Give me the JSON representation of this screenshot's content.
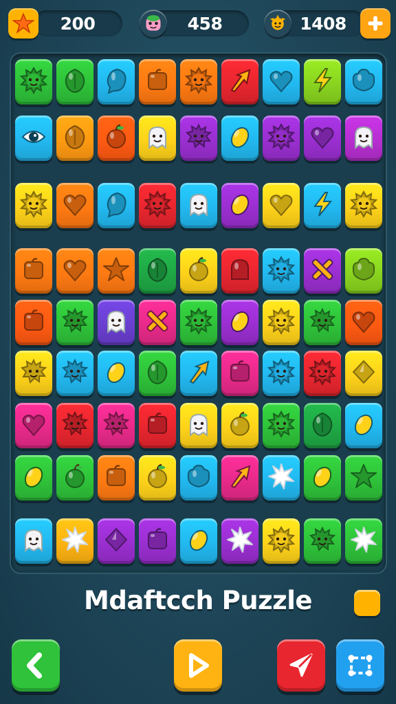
{
  "hud": {
    "coins": "200",
    "lives": "458",
    "score": "1408"
  },
  "board": {
    "rows": [
      [
        {
          "color": "#2fc23a",
          "icon": "sun-face"
        },
        {
          "color": "#2fc23a",
          "icon": "leaf"
        },
        {
          "color": "#22b8f0",
          "icon": "drop"
        },
        {
          "color": "#ff7a12",
          "icon": "block"
        },
        {
          "color": "#ff7a12",
          "icon": "sun-face"
        },
        {
          "color": "#e8262f",
          "icon": "arrow"
        },
        {
          "color": "#22b8f0",
          "icon": "heart"
        },
        {
          "color": "#8ad420",
          "icon": "bolt"
        },
        {
          "color": "#22b8f0",
          "icon": "blob"
        }
      ],
      [
        {
          "color": "#22b8f0",
          "icon": "eye"
        },
        {
          "color": "#ff9a12",
          "icon": "leaf"
        },
        {
          "color": "#ff5a12",
          "icon": "apple"
        },
        {
          "color": "#ffd21a",
          "icon": "ghost-face"
        },
        {
          "color": "#9a2fd0",
          "icon": "spiky"
        },
        {
          "color": "#22b8f0",
          "icon": "lemon"
        },
        {
          "color": "#9a2fd0",
          "icon": "sun-face"
        },
        {
          "color": "#9a2fd0",
          "icon": "heart"
        },
        {
          "color": "#b62fd0",
          "icon": "ghost-face"
        }
      ],
      [
        {
          "color": "#ffd21a",
          "icon": "sun-face"
        },
        {
          "color": "#ff7a12",
          "icon": "heart"
        },
        {
          "color": "#22b8f0",
          "icon": "drop"
        },
        {
          "color": "#e8262f",
          "icon": "sun-face"
        },
        {
          "color": "#22b8f0",
          "icon": "ghost-face"
        },
        {
          "color": "#9a2fd0",
          "icon": "lemon"
        },
        {
          "color": "#ffd21a",
          "icon": "heart"
        },
        {
          "color": "#22b8f0",
          "icon": "bolt"
        },
        {
          "color": "#ffd21a",
          "icon": "sun-face"
        }
      ],
      [
        {
          "color": "#ff7a12",
          "icon": "block"
        },
        {
          "color": "#ff7a12",
          "icon": "heart"
        },
        {
          "color": "#ff7a12",
          "icon": "star"
        },
        {
          "color": "#1fa845",
          "icon": "leaf"
        },
        {
          "color": "#ffd21a",
          "icon": "apple"
        },
        {
          "color": "#e8262f",
          "icon": "bell"
        },
        {
          "color": "#22b8f0",
          "icon": "sun-face"
        },
        {
          "color": "#9a2fd0",
          "icon": "cross"
        },
        {
          "color": "#8ad420",
          "icon": "blob"
        }
      ],
      [
        {
          "color": "#ff5a12",
          "icon": "block"
        },
        {
          "color": "#2fc23a",
          "icon": "spiky"
        },
        {
          "color": "#6a3fd0",
          "icon": "ghost-face"
        },
        {
          "color": "#e82a8a",
          "icon": "cross"
        },
        {
          "color": "#2fc23a",
          "icon": "sun-face"
        },
        {
          "color": "#9a2fd0",
          "icon": "lemon"
        },
        {
          "color": "#ffd21a",
          "icon": "sun-face"
        },
        {
          "color": "#2fc23a",
          "icon": "spiky"
        },
        {
          "color": "#ff5a12",
          "icon": "heart"
        }
      ],
      [
        {
          "color": "#ffd21a",
          "icon": "spiky"
        },
        {
          "color": "#22b8f0",
          "icon": "spiky"
        },
        {
          "color": "#22b8f0",
          "icon": "lemon"
        },
        {
          "color": "#2fc23a",
          "icon": "leaf"
        },
        {
          "color": "#22b8f0",
          "icon": "arrow"
        },
        {
          "color": "#e82a8a",
          "icon": "block"
        },
        {
          "color": "#22b8f0",
          "icon": "sun-face"
        },
        {
          "color": "#e8262f",
          "icon": "sun-face"
        },
        {
          "color": "#ffd21a",
          "icon": "diamond"
        }
      ],
      [
        {
          "color": "#e82a8a",
          "icon": "heart"
        },
        {
          "color": "#e8262f",
          "icon": "spiky"
        },
        {
          "color": "#e82a8a",
          "icon": "spiky"
        },
        {
          "color": "#e8262f",
          "icon": "block"
        },
        {
          "color": "#ffd21a",
          "icon": "ghost-face"
        },
        {
          "color": "#ffd21a",
          "icon": "apple"
        },
        {
          "color": "#2fc23a",
          "icon": "sun-face"
        },
        {
          "color": "#1fa845",
          "icon": "leaf"
        },
        {
          "color": "#22b8f0",
          "icon": "lemon"
        }
      ],
      [
        {
          "color": "#2fc23a",
          "icon": "lemon"
        },
        {
          "color": "#2fc23a",
          "icon": "apple"
        },
        {
          "color": "#ff7a12",
          "icon": "block"
        },
        {
          "color": "#ffd21a",
          "icon": "apple"
        },
        {
          "color": "#22b8f0",
          "icon": "blob"
        },
        {
          "color": "#e82a8a",
          "icon": "arrow"
        },
        {
          "color": "#22b8f0",
          "icon": "burst"
        },
        {
          "color": "#2fc23a",
          "icon": "lemon"
        },
        {
          "color": "#2fc23a",
          "icon": "star"
        }
      ],
      [
        {
          "color": "#22b8f0",
          "icon": "ghost-face"
        },
        {
          "color": "#ffb312",
          "icon": "burst"
        },
        {
          "color": "#9a2fd0",
          "icon": "diamond"
        },
        {
          "color": "#9a2fd0",
          "icon": "block"
        },
        {
          "color": "#22b8f0",
          "icon": "lemon"
        },
        {
          "color": "#9a2fd0",
          "icon": "burst"
        },
        {
          "color": "#ffd21a",
          "icon": "sun-face"
        },
        {
          "color": "#2fc23a",
          "icon": "spiky"
        },
        {
          "color": "#2fc23a",
          "icon": "burst"
        }
      ]
    ]
  },
  "title": "Mdaftcch Puzzle",
  "buttons": {
    "back_color": "#2fc23a",
    "play_color": "#ffb312",
    "send_color": "#e8262f",
    "shuffle_color": "#22a0f0"
  }
}
